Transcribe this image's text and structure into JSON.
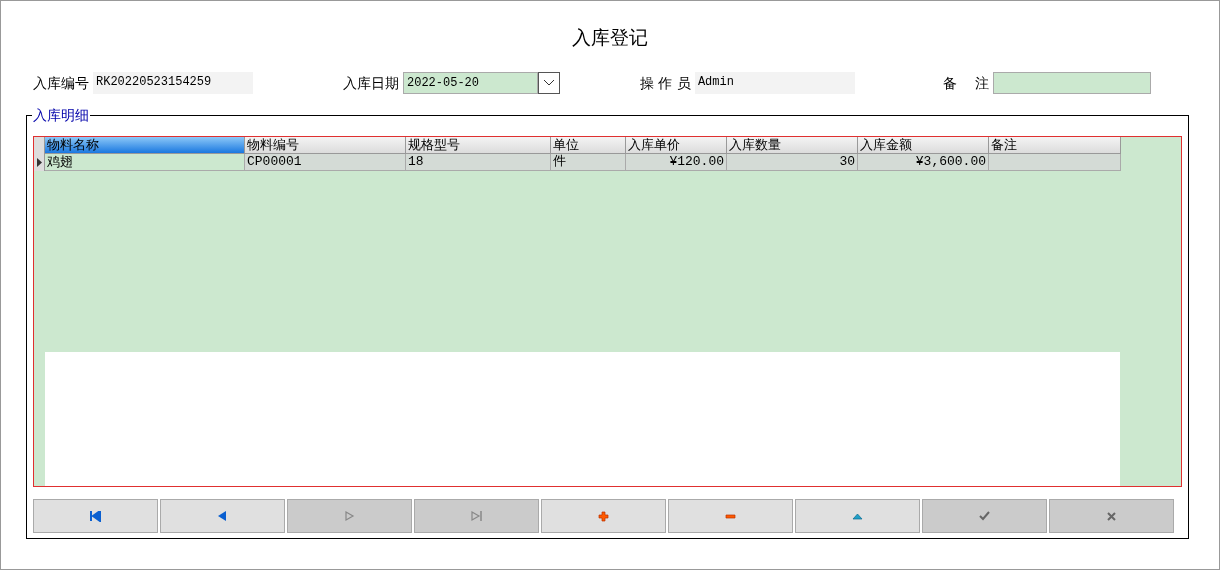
{
  "title": "入库登记",
  "fields": [
    {
      "label": "入库编号",
      "value": "RK20220523154259",
      "kind": "readonly"
    },
    {
      "label": "入库日期",
      "value": "2022-05-20",
      "kind": "date"
    },
    {
      "label": "操 作 员",
      "value": "Admin",
      "kind": "readonly"
    },
    {
      "label": "备　 注",
      "kind": "input"
    }
  ],
  "group": {
    "title": "入库明细"
  },
  "table": {
    "columns": [
      {
        "label": "物料名称",
        "selected": true,
        "kind": "text"
      },
      {
        "label": "物料编号",
        "selected": false,
        "kind": "text"
      },
      {
        "label": "规格型号",
        "selected": false,
        "kind": "text"
      },
      {
        "label": "单位",
        "selected": false,
        "kind": "text"
      },
      {
        "label": "入库单价",
        "selected": false,
        "kind": "number"
      },
      {
        "label": "入库数量",
        "selected": false,
        "kind": "number"
      },
      {
        "label": "入库金额",
        "selected": false,
        "kind": "number"
      },
      {
        "label": "备注",
        "selected": false,
        "kind": "text"
      }
    ],
    "rows": [
      {
        "current": true,
        "cells": [
          "鸡翅",
          "CP00001",
          "18",
          "件",
          "¥120.00",
          "30",
          "¥3,600.00",
          ""
        ]
      }
    ]
  },
  "buttons": [
    {
      "kind": "first",
      "disabled": false
    },
    {
      "kind": "prev",
      "disabled": false
    },
    {
      "kind": "next",
      "disabled": true
    },
    {
      "kind": "last",
      "disabled": true
    },
    {
      "kind": "add",
      "disabled": false
    },
    {
      "kind": "delete",
      "disabled": false
    },
    {
      "kind": "edit",
      "disabled": false
    },
    {
      "kind": "save",
      "disabled": true
    },
    {
      "kind": "cancel",
      "disabled": true
    }
  ]
}
